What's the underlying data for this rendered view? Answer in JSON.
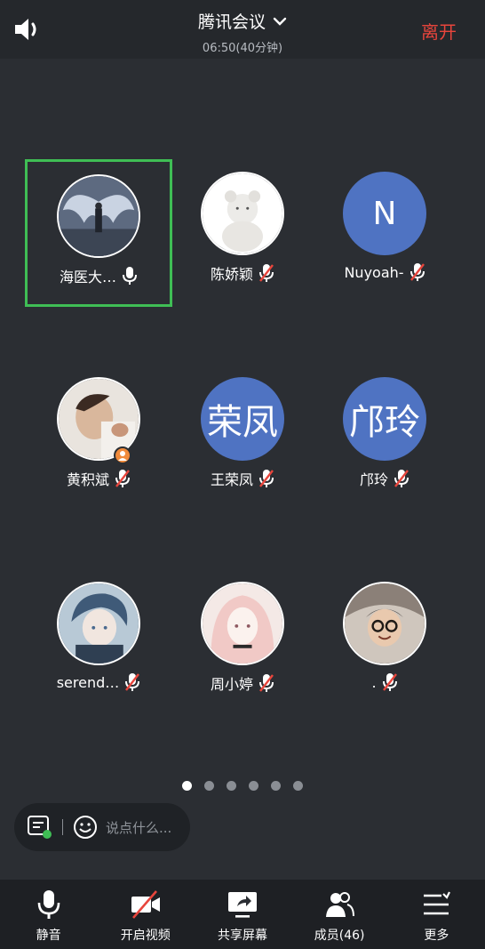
{
  "header": {
    "title": "腾讯会议",
    "duration": "06:50(40分钟)",
    "leave_label": "离开"
  },
  "participants": [
    {
      "name": "海医大…",
      "avatar": "photo-angel-wings",
      "mic": "on",
      "active": true
    },
    {
      "name": "陈娇颖",
      "avatar": "photo-white-bear",
      "mic": "muted"
    },
    {
      "name": "Nuyoah-",
      "avatar_text": "N",
      "mic": "muted"
    },
    {
      "name": "黄积斌",
      "avatar": "photo-person",
      "mic": "muted",
      "host": true
    },
    {
      "name": "王荣凤",
      "avatar_text": "荣凤",
      "mic": "muted"
    },
    {
      "name": "邝玲",
      "avatar_text": "邝玲",
      "mic": "muted"
    },
    {
      "name": "serend…",
      "avatar": "photo-anime-boy",
      "mic": "muted"
    },
    {
      "name": "周小婷",
      "avatar": "photo-anime-girl",
      "mic": "muted"
    },
    {
      "name": ".",
      "avatar": "photo-girl-glasses",
      "mic": "muted"
    }
  ],
  "pagination": {
    "pages": 6,
    "current": 1
  },
  "chat": {
    "placeholder": "说点什么..."
  },
  "toolbar": {
    "mute_label": "静音",
    "video_label": "开启视频",
    "share_label": "共享屏幕",
    "members_label": "成员(46)",
    "more_label": "更多"
  },
  "colors": {
    "background": "#2b2e33",
    "accent_red": "#e8453c",
    "active_border": "#3fbe55",
    "avatar_blue": "#4f73c2"
  }
}
